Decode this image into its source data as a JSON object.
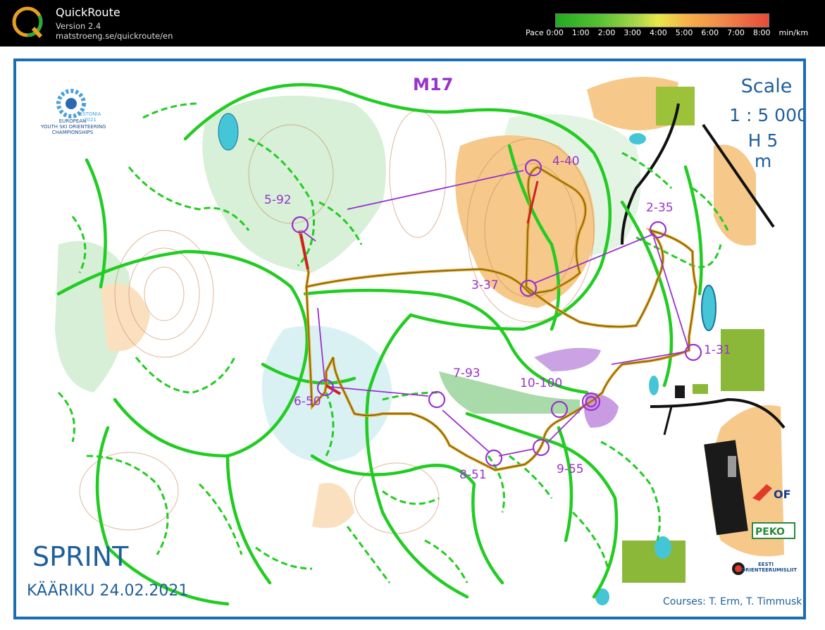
{
  "app": {
    "title": "QuickRoute",
    "version": "Version 2.4",
    "url": "matstroeng.se/quickroute/en"
  },
  "pace": {
    "labels": [
      "Pace 0:00",
      "1:00",
      "2:00",
      "3:00",
      "4:00",
      "5:00",
      "6:00",
      "7:00",
      "8:00",
      "min/km"
    ]
  },
  "map": {
    "course": "M17",
    "scale_label": "Scale",
    "scale_value": "1 : 5 000",
    "contour": "H 5 m",
    "event_title": "SPRINT",
    "event_sub": "KÄÄRIKU 24.02.2021",
    "credits": "Courses: T. Erm, T. Timmusk",
    "ctrl_labels": [
      "1-31",
      "2-35",
      "3-37",
      "4-40",
      "5-92",
      "6-50",
      "7-93",
      "8-51",
      "9-55",
      "10-100"
    ],
    "logo_left": "EUROPEAN\nYOUTH SKI ORIENTEERING\nCHAMPIONSHIPS",
    "logo_left_sub": "ESTONIA\n2021",
    "logo_right1": "IOF",
    "logo_right2": "PEKO",
    "logo_right3": "EESTI\nORIENTEERUMISLIIT"
  },
  "colors": {
    "trail": "#22cc22",
    "course_line": "#9932cc",
    "open_land": "#f6c98a",
    "border": "#1a6db3"
  }
}
